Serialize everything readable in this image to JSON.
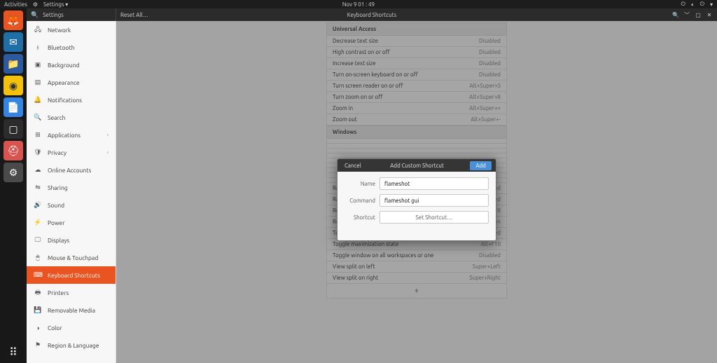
{
  "topbar": {
    "activities": "Activities",
    "app_indicator": "Settings ▾",
    "clock": "Nov 9  01 : 49"
  },
  "dock": {
    "items": [
      "firefox",
      "thunderbird",
      "files",
      "rhythmbox",
      "software",
      "help",
      "settings"
    ]
  },
  "settings_header": {
    "left_title": "Settings",
    "reset_all": "Reset All…",
    "right_title": "Keyboard Shortcuts"
  },
  "sidebar": {
    "items": [
      {
        "icon": "🖧",
        "label": "Network"
      },
      {
        "icon": "ᚼ",
        "label": "Bluetooth"
      },
      {
        "icon": "▣",
        "label": "Background"
      },
      {
        "icon": "▤",
        "label": "Appearance"
      },
      {
        "icon": "🔔",
        "label": "Notifications"
      },
      {
        "icon": "🔍",
        "label": "Search"
      },
      {
        "icon": "⊞",
        "label": "Applications",
        "chev": "›"
      },
      {
        "icon": "🛡",
        "label": "Privacy",
        "chev": "›"
      },
      {
        "icon": "☁",
        "label": "Online Accounts"
      },
      {
        "icon": "⇋",
        "label": "Sharing"
      },
      {
        "icon": "🔊",
        "label": "Sound"
      },
      {
        "icon": "⚡",
        "label": "Power"
      },
      {
        "icon": "🖵",
        "label": "Displays"
      },
      {
        "icon": "🖱",
        "label": "Mouse & Touchpad"
      },
      {
        "icon": "⌨",
        "label": "Keyboard Shortcuts",
        "active": true
      },
      {
        "icon": "🖶",
        "label": "Printers"
      },
      {
        "icon": "💾",
        "label": "Removable Media"
      },
      {
        "icon": "◑",
        "label": "Color"
      },
      {
        "icon": "⚑",
        "label": "Region & Language"
      }
    ]
  },
  "main": {
    "groups": [
      {
        "header": "Universal Access",
        "rows": [
          {
            "label": "Decrease text size",
            "value": "Disabled"
          },
          {
            "label": "High contrast on or off",
            "value": "Disabled"
          },
          {
            "label": "Increase text size",
            "value": "Disabled"
          },
          {
            "label": "Turn on-screen keyboard on or off",
            "value": "Disabled"
          },
          {
            "label": "Turn screen reader on or off",
            "value": "Alt+Super+S"
          },
          {
            "label": "Turn zoom on or off",
            "value": "Alt+Super+8"
          },
          {
            "label": "Zoom in",
            "value": "Alt+Super+="
          },
          {
            "label": "Zoom out",
            "value": "Alt+Super+-"
          }
        ]
      },
      {
        "header": "Windows",
        "rows": [
          {
            "label": "",
            "value": ""
          },
          {
            "label": "",
            "value": ""
          },
          {
            "label": "",
            "value": ""
          },
          {
            "label": "",
            "value": ""
          },
          {
            "label": "",
            "value": ""
          },
          {
            "label": "",
            "value": ""
          },
          {
            "label": "",
            "value": ""
          },
          {
            "label": "",
            "value": ""
          },
          {
            "label": "",
            "value": ""
          },
          {
            "label": "Raise window above other windows",
            "value": "Disabled"
          },
          {
            "label": "Raise window if covered, otherwise lower it",
            "value": "Disabled"
          },
          {
            "label": "Resize window",
            "value": "Alt+F8"
          },
          {
            "label": "Restore window",
            "value": "Super+Down"
          },
          {
            "label": "Toggle fullscreen mode",
            "value": "Disabled"
          },
          {
            "label": "Toggle maximization state",
            "value": "Alt+F10"
          },
          {
            "label": "Toggle window on all workspaces or one",
            "value": "Disabled"
          },
          {
            "label": "View split on left",
            "value": "Super+Left"
          },
          {
            "label": "View split on right",
            "value": "Super+Right"
          }
        ]
      }
    ],
    "add_icon": "+"
  },
  "dialog": {
    "cancel": "Cancel",
    "title": "Add Custom Shortcut",
    "add": "Add",
    "name_label": "Name",
    "name_value": "flameshot",
    "command_label": "Command",
    "command_value": "flameshot gui",
    "shortcut_label": "Shortcut",
    "set_shortcut": "Set Shortcut…"
  }
}
